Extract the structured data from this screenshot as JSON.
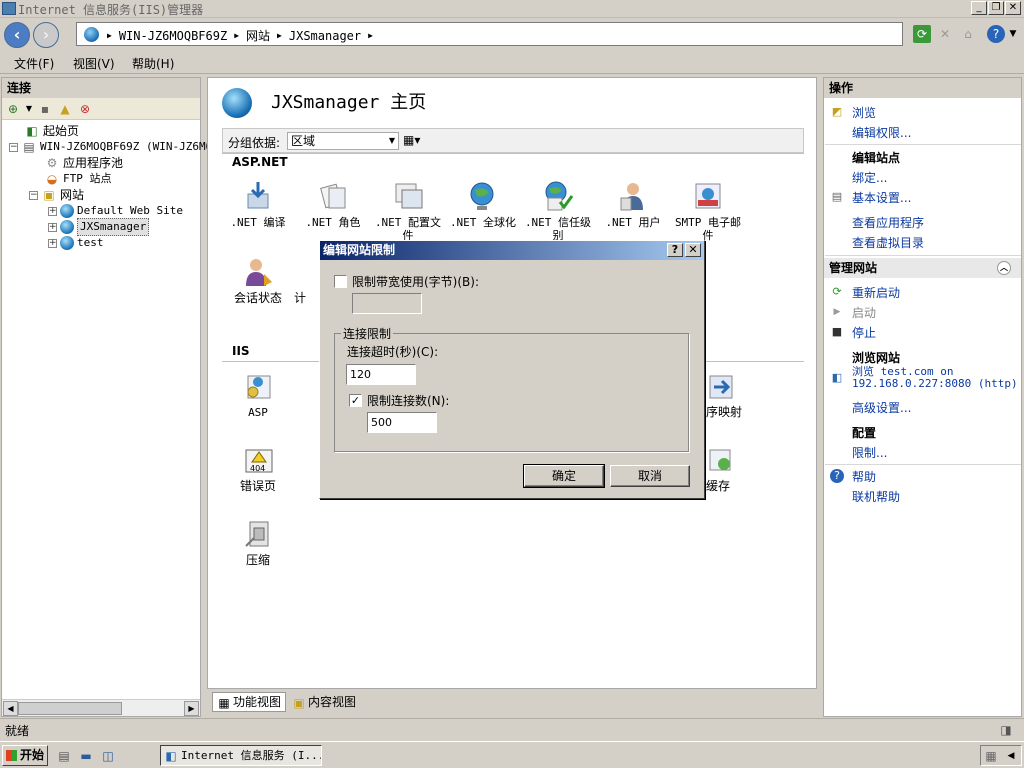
{
  "window": {
    "title": "Internet 信息服务(IIS)管理器"
  },
  "address": {
    "crumbs": [
      "WIN-JZ6MOQBF69Z",
      "网站",
      "JXSmanager"
    ]
  },
  "menu": {
    "items": [
      "文件(F)",
      "视图(V)",
      "帮助(H)"
    ]
  },
  "left_pane": {
    "header": "连接",
    "tree": {
      "start_page": "起始页",
      "server": "WIN-JZ6MOQBF69Z (WIN-JZ6MO",
      "app_pools": "应用程序池",
      "ftp_sites": "FTP 站点",
      "sites": "网站",
      "site_default": "Default Web Site",
      "site_jxs": "JXSmanager",
      "site_test": "test"
    }
  },
  "center": {
    "title": "JXSmanager 主页",
    "group_label": "分组依据:",
    "group_value": "区域",
    "sections": {
      "aspnet": "ASP.NET",
      "iis": "IIS"
    },
    "features": {
      "net_compile": ".NET 编译",
      "net_roles": ".NET 角色",
      "net_profile": ".NET 配置文件",
      "net_global": ".NET 全球化",
      "net_trust": ".NET 信任级别",
      "net_users": ".NET 用户",
      "smtp": "SMTP 电子邮件",
      "session": "会话状态",
      "session_partial": "计",
      "asp": "ASP",
      "handler_partial": "程序映射",
      "error_pages": "错误页",
      "cache_partial": "缓存",
      "compression": "压缩"
    },
    "tabs": {
      "features_view": "功能视图",
      "content_view": "内容视图"
    }
  },
  "right_pane": {
    "header": "操作",
    "browse": "浏览",
    "edit_perms": "编辑权限...",
    "edit_site": "编辑站点",
    "bindings": "绑定...",
    "basic_settings": "基本设置...",
    "view_apps": "查看应用程序",
    "view_vdirs": "查看虚拟目录",
    "manage_site": "管理网站",
    "restart": "重新启动",
    "start": "启动",
    "stop": "停止",
    "browse_site": "浏览网站",
    "browse_link_1": "浏览 test.com on",
    "browse_link_2": "192.168.0.227:8080 (http)",
    "advanced": "高级设置...",
    "config": "配置",
    "limits": "限制...",
    "help_head": "帮助",
    "online_help": "联机帮助"
  },
  "dialog": {
    "title": "编辑网站限制",
    "limit_bandwidth_label": "限制带宽使用(字节)(B):",
    "limit_bandwidth_checked": false,
    "bandwidth_value": "",
    "group_label": "连接限制",
    "timeout_label": "连接超时(秒)(C):",
    "timeout_value": "120",
    "limit_conn_label": "限制连接数(N):",
    "limit_conn_checked": true,
    "conn_value": "500",
    "ok": "确定",
    "cancel": "取消"
  },
  "status": {
    "text": "就绪"
  },
  "taskbar": {
    "start": "开始",
    "task": "Internet 信息服务 (I..."
  }
}
